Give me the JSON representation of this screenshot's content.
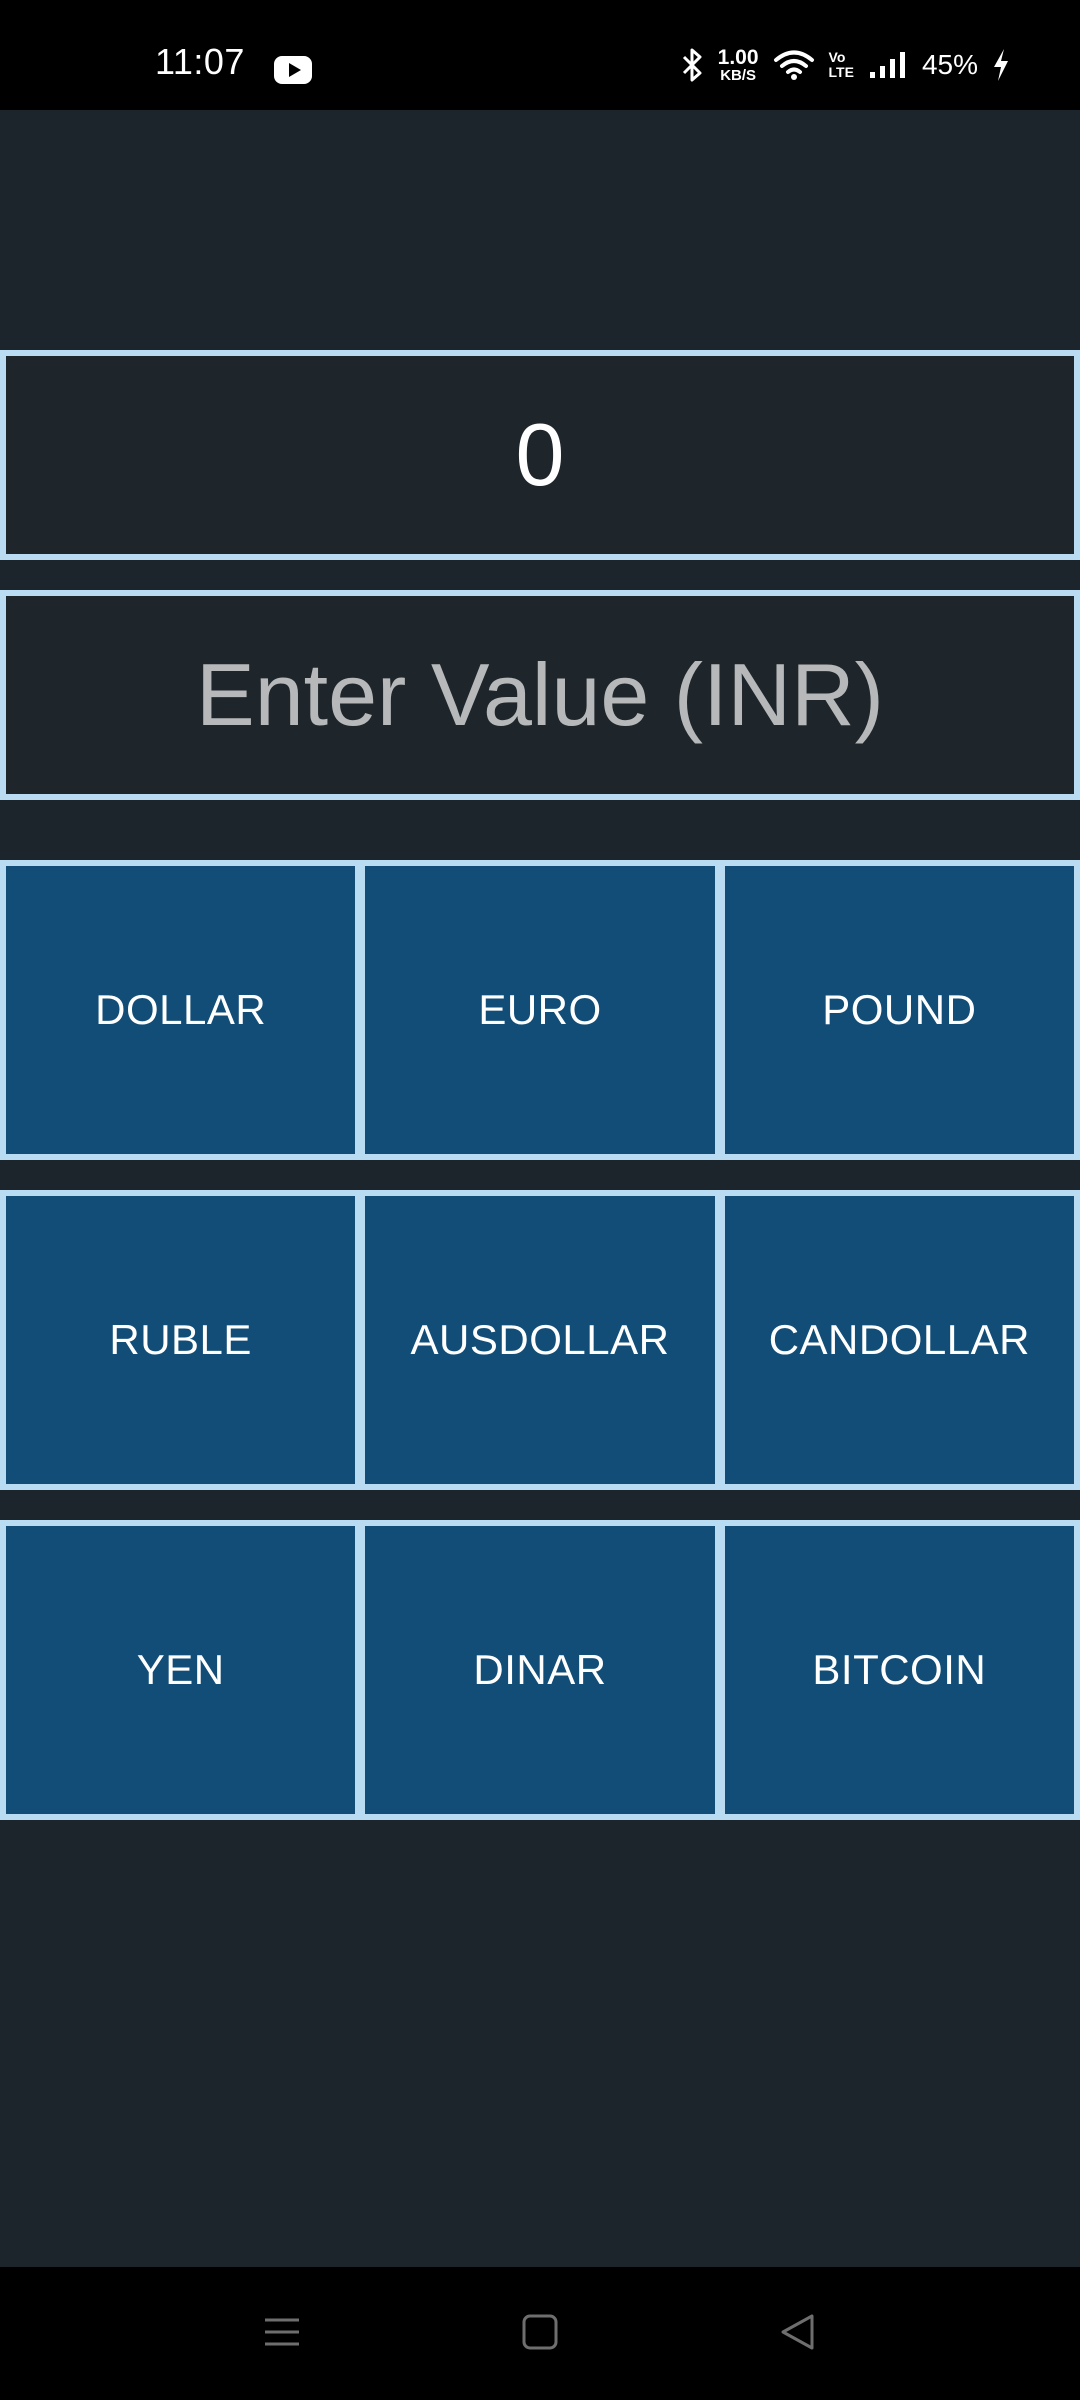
{
  "status_bar": {
    "time": "11:07",
    "net_speed_value": "1.00",
    "net_speed_unit": "KB/S",
    "volte_top": "Vo",
    "volte_bottom": "LTE",
    "battery": "45%",
    "icons": [
      "youtube-icon",
      "bluetooth-icon",
      "wifi-icon",
      "signal-icon",
      "charging-icon"
    ]
  },
  "converter": {
    "result": "0",
    "input_value": "",
    "input_placeholder": "Enter Value (INR)",
    "buttons": [
      [
        "DOLLAR",
        "EURO",
        "POUND"
      ],
      [
        "RUBLE",
        "AUSDOLLAR",
        "CANDOLLAR"
      ],
      [
        "YEN",
        "DINAR",
        "BITCOIN"
      ]
    ]
  },
  "nav_bar": {
    "icons": [
      "menu-icon",
      "home-icon",
      "back-icon"
    ]
  },
  "colors": {
    "background": "#1d252c",
    "border": "#b9dcf3",
    "button": "#114d77",
    "text": "#ffffff",
    "placeholder": "#b6b8b9"
  }
}
